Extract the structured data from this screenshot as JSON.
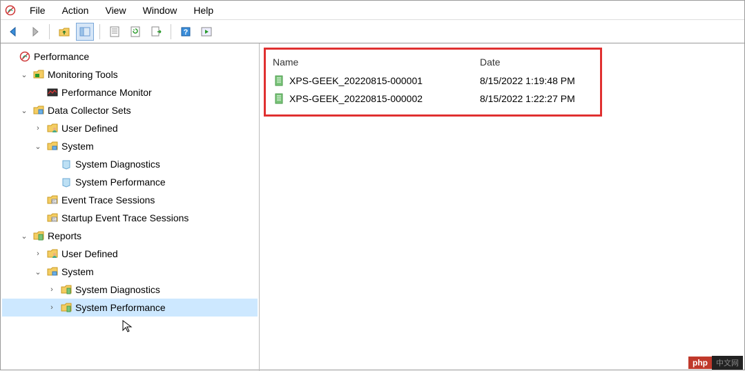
{
  "menu": {
    "items": [
      "File",
      "Action",
      "View",
      "Window",
      "Help"
    ]
  },
  "tree": {
    "root": "Performance",
    "monitoring_tools": "Monitoring Tools",
    "performance_monitor": "Performance Monitor",
    "data_collector_sets": "Data Collector Sets",
    "dcs_user_defined": "User Defined",
    "dcs_system": "System",
    "dcs_system_diagnostics": "System Diagnostics",
    "dcs_system_performance": "System Performance",
    "event_trace_sessions": "Event Trace Sessions",
    "startup_event_trace_sessions": "Startup Event Trace Sessions",
    "reports": "Reports",
    "rep_user_defined": "User Defined",
    "rep_system": "System",
    "rep_system_diagnostics": "System Diagnostics",
    "rep_system_performance": "System Performance"
  },
  "list": {
    "headers": {
      "name": "Name",
      "date": "Date"
    },
    "rows": [
      {
        "name": "XPS-GEEK_20220815-000001",
        "date": "8/15/2022 1:19:48 PM"
      },
      {
        "name": "XPS-GEEK_20220815-000002",
        "date": "8/15/2022 1:22:27 PM"
      }
    ]
  },
  "watermark": {
    "left": "php",
    "right": "中文网"
  }
}
